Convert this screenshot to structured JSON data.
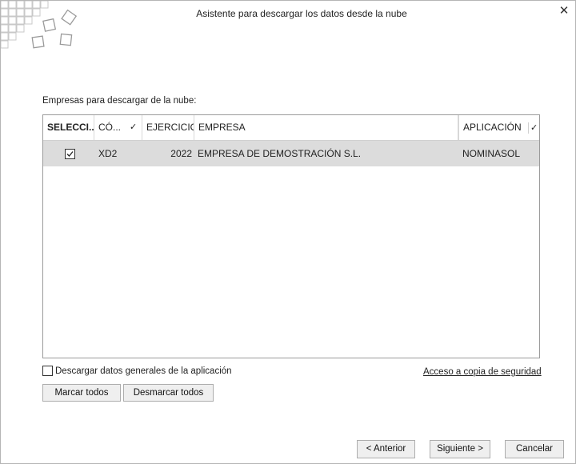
{
  "window": {
    "title": "Asistente para descargar los datos desde la nube",
    "close_glyph": "✕"
  },
  "companies": {
    "section_label": "Empresas para descargar de la nube:",
    "columns": {
      "select": "SELECCI...",
      "code": "CÓ...",
      "year": "EJERCICIO",
      "company": "EMPRESA",
      "app": "APLICACIÓN"
    },
    "rows": [
      {
        "selected": true,
        "code": "XD2",
        "year": "2022",
        "company": "EMPRESA DE DEMOSTRACIÓN S.L.",
        "app": "NOMINASOL"
      }
    ]
  },
  "general_data": {
    "label": "Descargar datos generales de la aplicación",
    "checked": false
  },
  "backup_link": "Acceso a copia de seguridad",
  "selection_buttons": {
    "mark_all": "Marcar todos",
    "unmark_all": "Desmarcar todos"
  },
  "footer": {
    "previous": "< Anterior",
    "next": "Siguiente >",
    "cancel": "Cancelar"
  },
  "icons": {
    "logo": "tile-cluster-logo",
    "sort": "checkmark-sort-icon"
  }
}
